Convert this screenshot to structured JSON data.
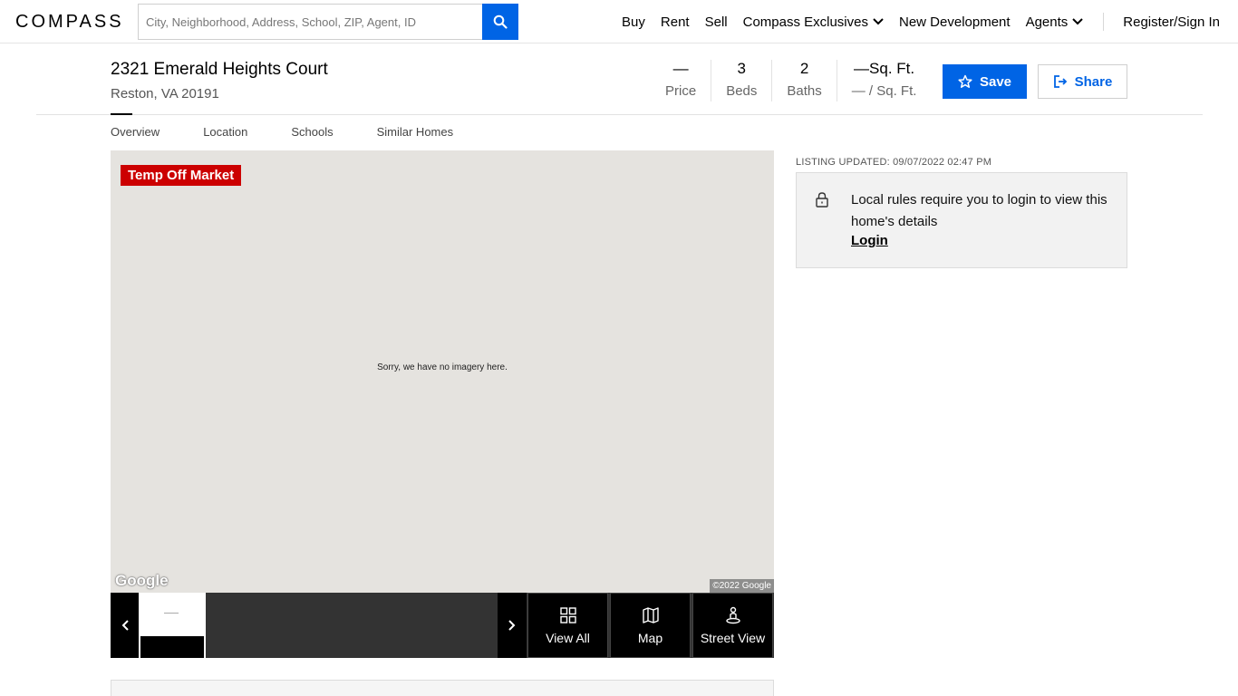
{
  "brand": {
    "logo": "COMPASS"
  },
  "search": {
    "placeholder": "City, Neighborhood, Address, School, ZIP, Agent, ID"
  },
  "nav": {
    "buy": "Buy",
    "rent": "Rent",
    "sell": "Sell",
    "exclusives": "Compass Exclusives",
    "new_dev": "New Development",
    "agents": "Agents",
    "register": "Register/Sign In"
  },
  "listing": {
    "address": "2321 Emerald Heights Court",
    "city": "Reston, VA 20191",
    "price_value": "—",
    "price_label": "Price",
    "beds_value": "3",
    "beds_label": "Beds",
    "baths_value": "2",
    "baths_label": "Baths",
    "sqft_value": "—Sq. Ft.",
    "sqft_label": "— / Sq. Ft."
  },
  "actions": {
    "save": "Save",
    "share": "Share"
  },
  "tabs": [
    "Overview",
    "Location",
    "Schools",
    "Similar Homes"
  ],
  "media": {
    "badge": "Temp Off Market",
    "no_imagery": "Sorry, we have no imagery here.",
    "google_logo": "Google",
    "copyright": "©2022 Google",
    "view_all": "View All",
    "map": "Map",
    "street_view": "Street View"
  },
  "sidebar": {
    "updated": "LISTING UPDATED: 09/07/2022 02:47 PM",
    "login_msg": "Local rules require you to login to view this home's details",
    "login_link": "Login"
  },
  "colors": {
    "accent": "#0064e5",
    "badge": "#cc0000"
  }
}
